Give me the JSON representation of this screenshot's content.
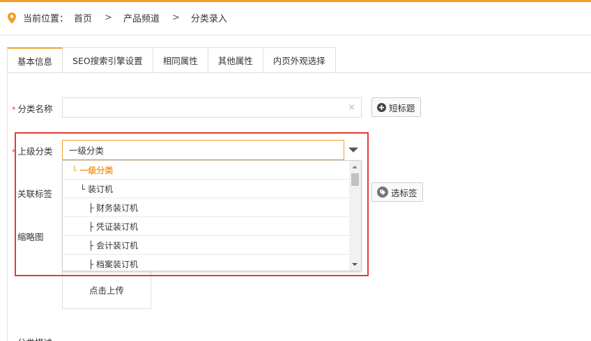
{
  "breadcrumb": {
    "prefix": "当前位置：",
    "items": [
      "首页",
      "产品频道",
      "分类录入"
    ],
    "separator": ">"
  },
  "tabs": [
    {
      "label": "基本信息",
      "active": true
    },
    {
      "label": "SEO搜索引擎设置",
      "active": false
    },
    {
      "label": "相同属性",
      "active": false
    },
    {
      "label": "其他属性",
      "active": false
    },
    {
      "label": "内页外观选择",
      "active": false
    }
  ],
  "form": {
    "required_mark": "*",
    "category_name": {
      "label": "分类名称",
      "value": "",
      "clear_glyph": "×"
    },
    "short_title_button": "短标题",
    "parent_category": {
      "label": "上级分类",
      "value": "一级分类"
    },
    "related_tags": {
      "label": "关联标签"
    },
    "select_tags_button": "选标签",
    "thumbnail": {
      "label": "缩略图",
      "upload_label": "点击上传"
    },
    "description_label": "分类描述"
  },
  "dropdown": {
    "options": [
      {
        "label": "└ 一级分类",
        "selected": true,
        "indent": 0
      },
      {
        "label": "└ 装订机",
        "selected": false,
        "indent": 1
      },
      {
        "label": "├ 财务装订机",
        "selected": false,
        "indent": 2
      },
      {
        "label": "├ 凭证装订机",
        "selected": false,
        "indent": 2
      },
      {
        "label": "├ 会计装订机",
        "selected": false,
        "indent": 2
      },
      {
        "label": "├ 档案装订机",
        "selected": false,
        "indent": 2
      }
    ]
  },
  "colors": {
    "accent": "#f39c2a",
    "highlight_box": "#e53935",
    "required": "#e33333"
  },
  "icons": {
    "location": "location-pin-icon",
    "plus": "plus-circle-icon",
    "tag": "tag-icon",
    "dropdown": "caret-down-icon"
  }
}
